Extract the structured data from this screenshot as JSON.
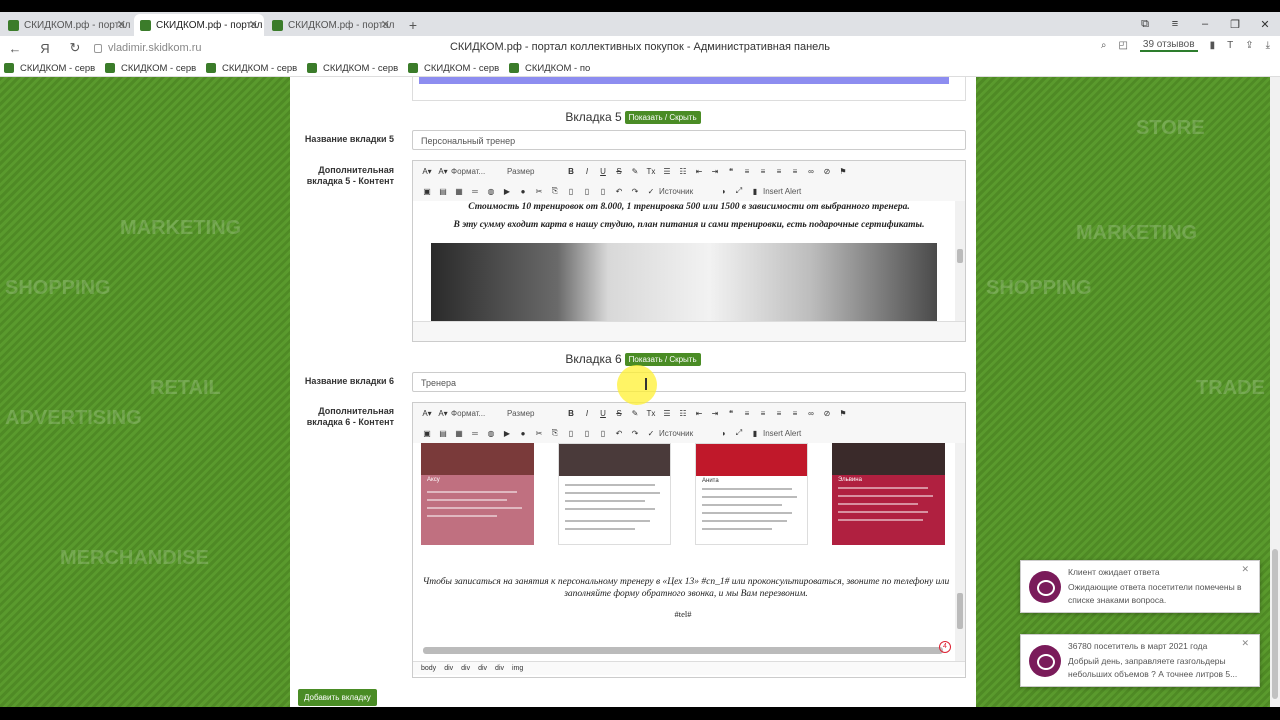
{
  "browser": {
    "tabs": [
      {
        "title": "СКИДКОМ.рф - портал ко",
        "active": false
      },
      {
        "title": "СКИДКОМ.рф - портал",
        "active": true
      },
      {
        "title": "СКИДКОМ.рф - портал ко",
        "active": false
      }
    ],
    "url": "vladimir.skidkom.ru",
    "page_title": "СКИДКОМ.рф - портал коллективных покупок - Административная панель",
    "reviews": "39 отзывов",
    "bookmarks": [
      "СКИДКОМ - серв",
      "СКИДКОМ - серв",
      "СКИДКОМ - серв",
      "СКИДКОМ - серв",
      "СКИДКОМ - серв",
      "СКИДКОМ - по"
    ]
  },
  "background": {
    "left_words": [
      "SHOPPING",
      "MARKETING",
      "ADVERTISING",
      "RETAIL",
      "MERCHANDISE"
    ],
    "right_words": [
      "SHOPPING",
      "MARKETING",
      "TRADE",
      "STORE"
    ]
  },
  "tab5": {
    "heading": "Вкладка 5",
    "toggle": "Показать / Скрыть",
    "name_label": "Название вкладки 5",
    "name_value": "Персональный тренер",
    "content_label": "Дополнительная вкладка 5 - Контент",
    "line1": "Стоимость 10 тренировок от 8.000, 1 тренировка 500 или 1500 в зависимости от выбранного тренера.",
    "line2": "В эту сумму входит карта в нашу студию, план питания и сами тренировки, есть подарочные сертификаты."
  },
  "tab6": {
    "heading": "Вкладка 6",
    "toggle": "Показать / Скрыть",
    "name_label": "Название вкладки 6",
    "name_value": "Тренера",
    "content_label": "Дополнительная вкладка 6 - Контент",
    "trainers": [
      "Аксу",
      "",
      "Анита",
      "Эльвина"
    ],
    "text": "Чтобы записаться на занятия к персональному тренеру в «Цех 13» #cn_1# или проконсультироваться, звоните по телефону или заполняйте форму обратного звонка, и мы Вам перезвоним.",
    "tel": "#tel#",
    "path": [
      "body",
      "div",
      "div",
      "div",
      "div",
      "img"
    ]
  },
  "toolbar": {
    "format": "Формат...",
    "size": "Размер",
    "source": "Источник",
    "insert_alert": "Insert Alert"
  },
  "add_tab": "Добавить вкладку",
  "notifications": [
    {
      "title": "Клиент ожидает ответа",
      "body": "Ожидающие ответа посетители помечены в списке знаками вопроса."
    },
    {
      "title": "36780 посетитель в март 2021 года",
      "body": "Добрый день, заправляете газгольдеры небольших объемов ? А точнее литров 5..."
    }
  ]
}
